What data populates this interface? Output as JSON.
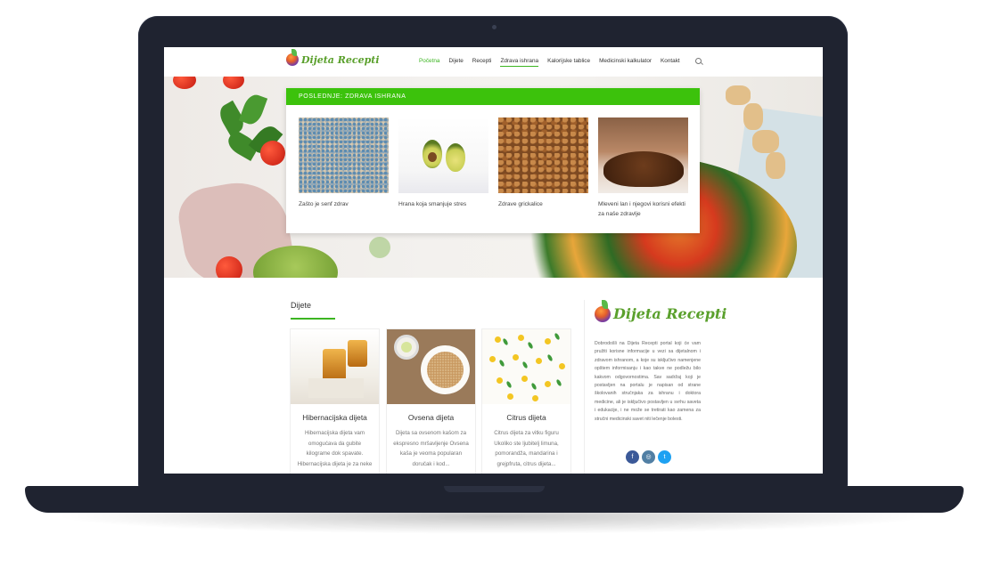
{
  "header": {
    "logo_text": "Dijeta Recepti",
    "nav": [
      {
        "label": "Početna",
        "active": true
      },
      {
        "label": "Dijete"
      },
      {
        "label": "Recepti"
      },
      {
        "label": "Zdrava ishrana",
        "underlined": true
      },
      {
        "label": "Kalorijske tablice"
      },
      {
        "label": "Medicinski kalkulator"
      },
      {
        "label": "Kontakt"
      }
    ]
  },
  "dropdown": {
    "heading": "POSLEDNJE: ZDRAVA ISHRANA",
    "items": [
      {
        "caption": "Zašto je senf zdrav"
      },
      {
        "caption": "Hrana koja smanjuje stres"
      },
      {
        "caption": "Zdrave grickalice"
      },
      {
        "caption": "Mleveni lan i njegovi korisni efekti za naše zdravlje"
      }
    ]
  },
  "section": {
    "title": "Dijete",
    "cards": [
      {
        "title": "Hibernacijska dijeta",
        "desc": "Hibernacijska dijeta vam omogućava da gubite kilograme dok spavate. Hibernacijska dijeta je za neke"
      },
      {
        "title": "Ovsena dijeta",
        "desc": "Dijeta sa ovsenom kašom za ekspresno mršavljenje Ovsena kaša je veoma popularan doručak i kod..."
      },
      {
        "title": "Citrus dijeta",
        "desc": "Citrus dijeta za vitku figuru Ukoliko ste ljubitelj limuna, pomorandža, mandarina i grejpfruta, citrus dijeta..."
      }
    ]
  },
  "sidebar": {
    "logo_text": "Dijeta Recepti",
    "about": "Dobrodošli na Dijeta Recepti portal koji će vam pružiti korisne informacije u vezi sa dijetalnom i zdravom ishranom, a koje su isključivo namenjene opštem informisanju i kao takve ne podležu bilo kakvom odgovornostima. Sav sadržaj koji je postavljen na portalu je napisan od strane školovanih stručnjaka za ishranu i doktora medicine, ali je isključivo postavljen u svrhu saveta i edukacije, i ne može se tretirati kao zamena za stručni medicinski savet niti lečenje bolesti.",
    "social": [
      "facebook-icon",
      "instagram-icon",
      "twitter-icon"
    ]
  },
  "colors": {
    "accent": "#3cb521",
    "dropdown_bar": "#3cc20c",
    "laptop": "#1f2330"
  }
}
